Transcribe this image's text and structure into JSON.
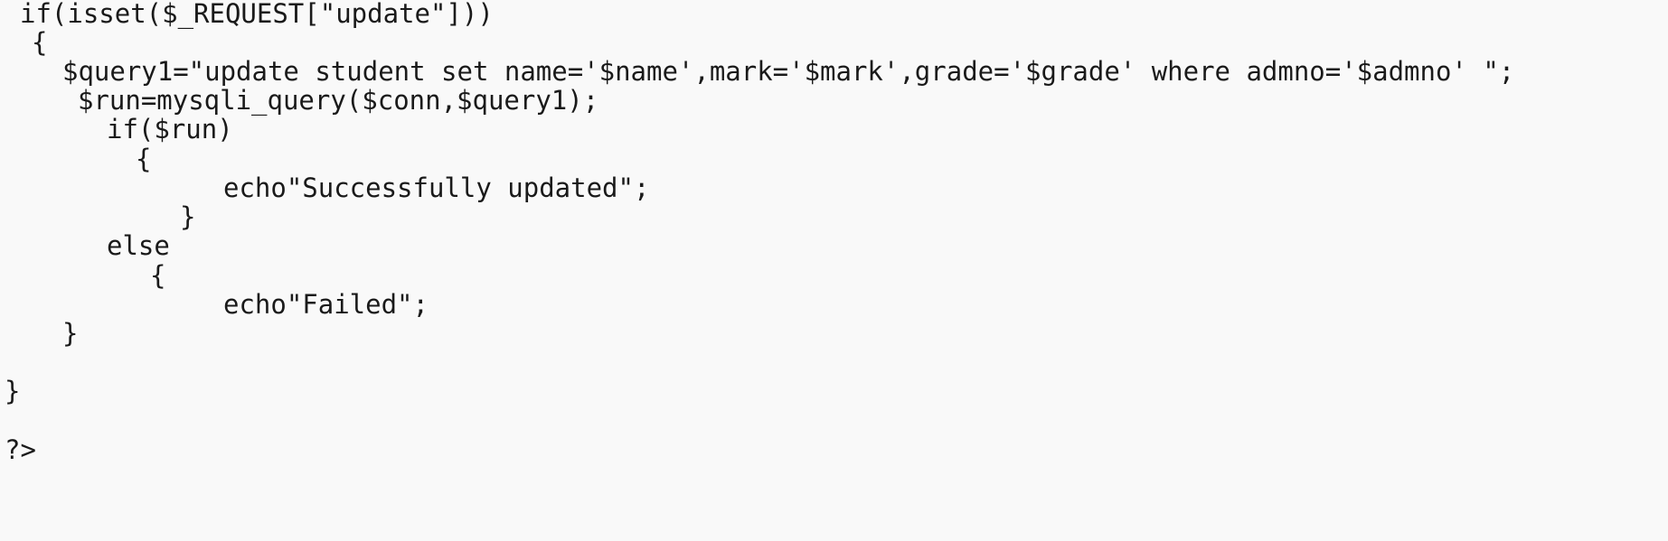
{
  "code": {
    "language": "php",
    "lines": [
      "if(isset($_REQUEST[\"update\"]))",
      "{",
      "$query1=\"update student set name='$name',mark='$mark',grade='$grade' where admno='$admno' \";",
      "$run=mysqli_query($conn,$query1);",
      "if($run)",
      "{",
      "echo\"Successfully updated\";",
      "}",
      "else",
      "{",
      "echo\"Failed\";",
      "}",
      "}",
      "?>"
    ]
  },
  "colors": {
    "background": "#f9f9f9",
    "text": "#1a1a1a"
  }
}
